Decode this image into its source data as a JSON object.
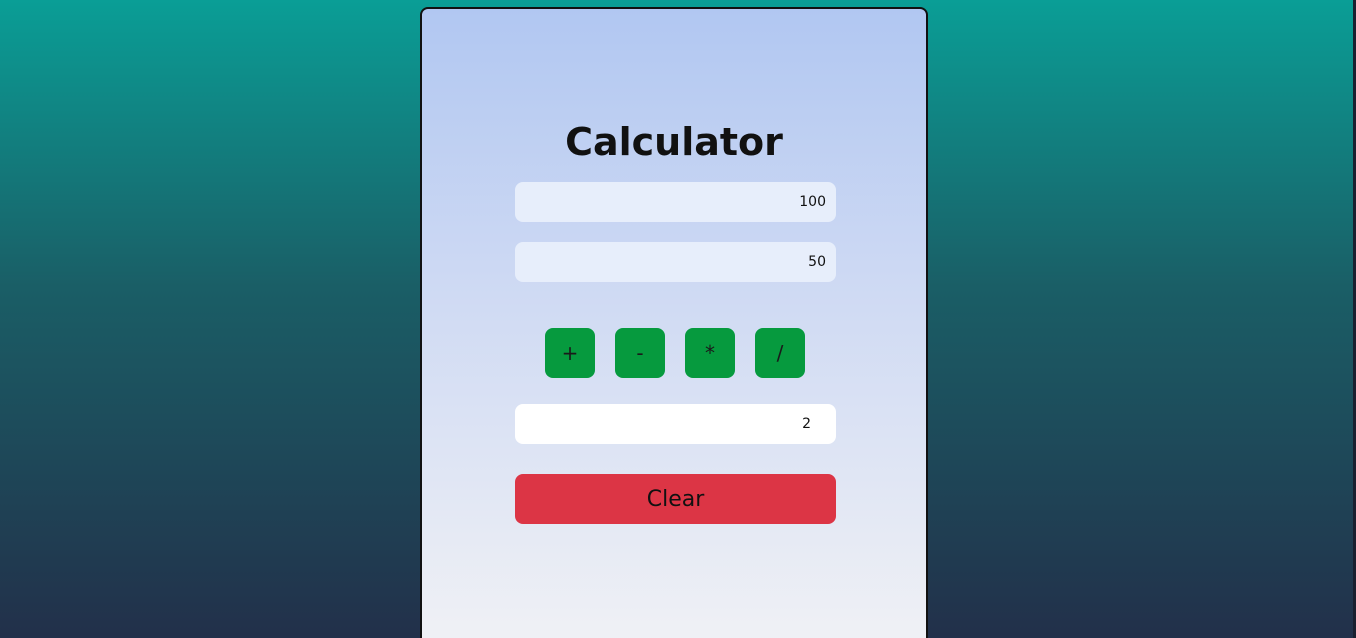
{
  "app": {
    "title": "Calculator"
  },
  "inputs": {
    "first_value": "100",
    "second_value": "50"
  },
  "operations": [
    {
      "label": "+"
    },
    {
      "label": "-"
    },
    {
      "label": "*"
    },
    {
      "label": "/"
    }
  ],
  "result": {
    "value": "2"
  },
  "actions": {
    "clear_label": "Clear"
  },
  "colors": {
    "operator_button": "#069a3e",
    "clear_button": "#dc3545",
    "card_top": "#b1c7f2",
    "card_bottom": "#f0f1f5",
    "page_top": "#0a9e96",
    "page_bottom": "#22304a"
  }
}
